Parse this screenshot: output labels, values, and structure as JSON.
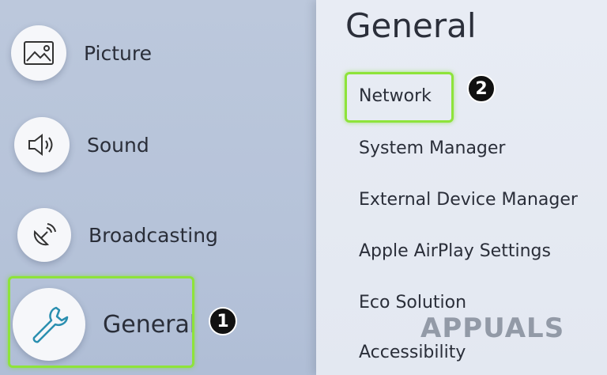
{
  "left_menu": {
    "items": [
      {
        "label": "Picture",
        "icon": "picture-icon"
      },
      {
        "label": "Sound",
        "icon": "sound-icon"
      },
      {
        "label": "Broadcasting",
        "icon": "broadcasting-icon"
      },
      {
        "label": "General",
        "icon": "wrench-icon"
      }
    ]
  },
  "panel": {
    "title": "General",
    "items": [
      {
        "label": "Network"
      },
      {
        "label": "System Manager"
      },
      {
        "label": "External Device Manager"
      },
      {
        "label": "Apple AirPlay Settings"
      },
      {
        "label": "Eco Solution"
      },
      {
        "label": "Accessibility"
      }
    ]
  },
  "annotations": {
    "step1": "1",
    "step2": "2",
    "highlight_color": "#8ee33a"
  },
  "watermark": {
    "text": "APPUALS"
  }
}
